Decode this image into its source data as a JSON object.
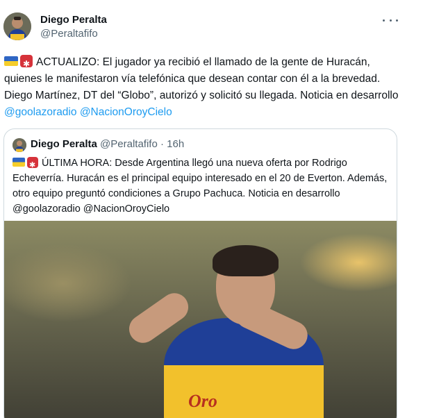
{
  "tweet": {
    "author_name": "Diego Peralta",
    "author_handle": "@Peraltafifo",
    "more_icon": "more-horizontal-icon",
    "body_prefix_icons": [
      "ukraine-flag-icon",
      "siren-icon"
    ],
    "body_text": "ACTUALIZO: El jugador ya recibió el llamado de la gente de Huracán, quienes le manifestaron vía telefónica que desean contar con él a la brevedad. Diego Martínez, DT del “Globo”, autorizó y solicitó su llegada. Noticia en desarrollo ",
    "mentions": [
      "@goolazoradio",
      "@NacionOroyCielo"
    ]
  },
  "quote": {
    "author_name": "Diego Peralta",
    "author_handle": "@Peraltafifo",
    "separator": "·",
    "time": "16h",
    "body_text": "ÚLTIMA HORA: Desde Argentina llegó una nueva oferta por Rodrigo Echeverría. Huracán es el principal equipo interesado en el 20 de Everton. Además, otro equipo preguntó condiciones a Grupo Pachuca. Noticia en desarrollo @goolazoradio @NacionOroyCielo",
    "image_sponsor_text": "Oro"
  },
  "colors": {
    "link": "#1d9bf0",
    "secondary_text": "#536471",
    "border": "#cfd9de"
  }
}
